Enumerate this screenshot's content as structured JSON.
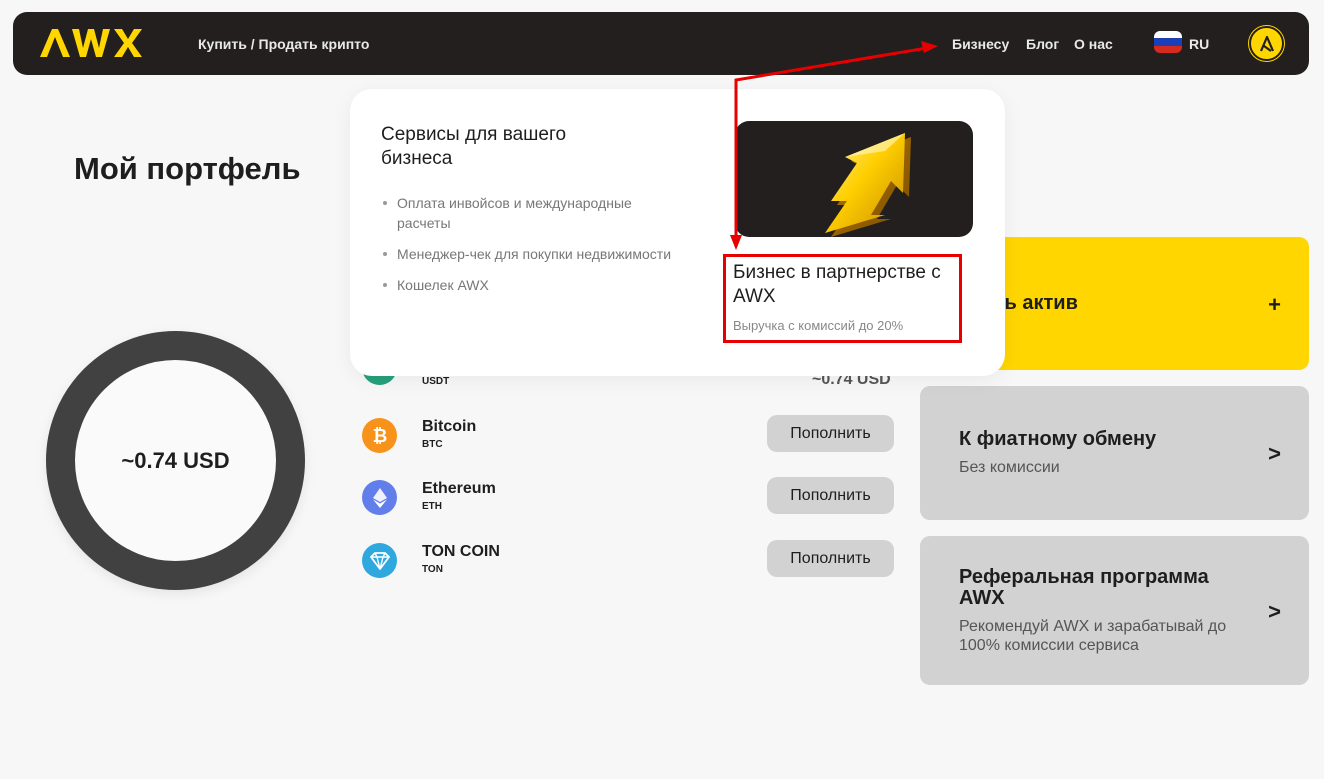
{
  "header": {
    "brand": "AWX",
    "nav_buy_sell": "Купить / Продать крипто",
    "nav_business": "Бизнесу",
    "nav_blog": "Блог",
    "nav_about": "О нас",
    "language": "RU"
  },
  "page": {
    "title": "Мой портфель",
    "portfolio_total": "~0.74 USD"
  },
  "assets": [
    {
      "name": "",
      "symbol": "USDT",
      "amount": "~0.74 USD",
      "icon": "tether-icon",
      "color": "#26a17b"
    },
    {
      "name": "Bitcoin",
      "symbol": "BTC",
      "button": "Пополнить",
      "icon": "bitcoin-icon",
      "color": "#f7931a"
    },
    {
      "name": "Ethereum",
      "symbol": "ETH",
      "button": "Пополнить",
      "icon": "ethereum-icon",
      "color": "#627eea"
    },
    {
      "name": "TON COIN",
      "symbol": "TON",
      "button": "Пополнить",
      "icon": "ton-icon",
      "color": "#2ea8df"
    }
  ],
  "cards": {
    "add_asset": {
      "title": "авить актив",
      "action": "+"
    },
    "fiat": {
      "title": "К фиатному обмену",
      "subtitle": "Без комиссии",
      "arrow": ">"
    },
    "referral": {
      "title": "Реферальная программа AWX",
      "subtitle": "Рекомендуй AWX и зарабатывай до 100% комиссии сервиса",
      "arrow": ">"
    }
  },
  "dropdown": {
    "title": "Сервисы для вашего бизнеса",
    "items": [
      "Оплата инвойсов и международные расчеты",
      "Менеджер-чек для покупки недвижимости",
      "Кошелек AWX"
    ],
    "promo_title": "Бизнес в партнерстве с AWX",
    "promo_subtitle": "Выручка с комиссий до 20%"
  },
  "colors": {
    "brand_yellow": "#ffd600",
    "header_dark": "#231f1e",
    "annotation_red": "#e60000"
  }
}
